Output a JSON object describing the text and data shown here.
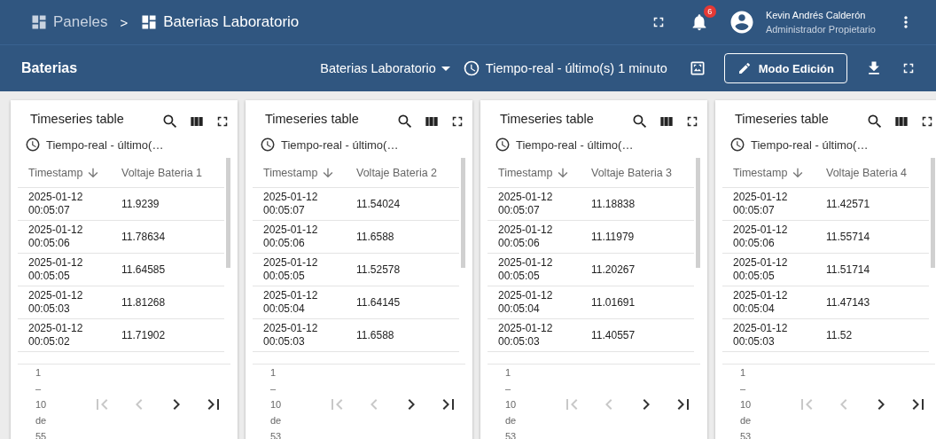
{
  "breadcrumb": [
    {
      "label": "Paneles",
      "current": false
    },
    {
      "label": ">",
      "kind": "separator"
    },
    {
      "label": "Baterias Laboratorio",
      "current": true
    }
  ],
  "notifications": {
    "badge": "6"
  },
  "user": {
    "name": "Kevin Andrés Calderón",
    "role": "Administrador Propietario"
  },
  "toolbar": {
    "title": "Baterias",
    "state_selector": "Baterias Laboratorio",
    "timewindow": "Tiempo-real - último(s) 1 minuto",
    "edit_button": "Modo Edición"
  },
  "panels": [
    {
      "title": "Timeseries table",
      "timewindow": "Tiempo-real - último(…",
      "columns": [
        {
          "label": "Timestamp",
          "sorted": true
        },
        {
          "label": "Voltaje Bateria 1",
          "sorted": false
        }
      ],
      "rows": [
        {
          "timestamp": "2025-01-12\n00:05:07",
          "value": "11.9239"
        },
        {
          "timestamp": "2025-01-12\n00:05:06",
          "value": "11.78634"
        },
        {
          "timestamp": "2025-01-12\n00:05:05",
          "value": "11.64585"
        },
        {
          "timestamp": "2025-01-12\n00:05:03",
          "value": "11.81268"
        },
        {
          "timestamp": "2025-01-12\n00:05:02",
          "value": "11.71902"
        }
      ],
      "pagination": [
        "1",
        "–",
        "10",
        "de",
        "55"
      ],
      "nav": [
        {
          "kind": "first",
          "disabled": true
        },
        {
          "kind": "prev",
          "disabled": true
        },
        {
          "kind": "next",
          "disabled": false
        },
        {
          "kind": "last",
          "disabled": false
        }
      ]
    },
    {
      "title": "Timeseries table",
      "timewindow": "Tiempo-real - último(…",
      "columns": [
        {
          "label": "Timestamp",
          "sorted": true
        },
        {
          "label": "Voltaje Bateria 2",
          "sorted": false
        }
      ],
      "rows": [
        {
          "timestamp": "2025-01-12\n00:05:07",
          "value": "11.54024"
        },
        {
          "timestamp": "2025-01-12\n00:05:06",
          "value": "11.6588"
        },
        {
          "timestamp": "2025-01-12\n00:05:05",
          "value": "11.52578"
        },
        {
          "timestamp": "2025-01-12\n00:05:04",
          "value": "11.64145"
        },
        {
          "timestamp": "2025-01-12\n00:05:03",
          "value": "11.6588"
        }
      ],
      "pagination": [
        "1",
        "–",
        "10",
        "de",
        "53"
      ],
      "nav": [
        {
          "kind": "first",
          "disabled": true
        },
        {
          "kind": "prev",
          "disabled": true
        },
        {
          "kind": "next",
          "disabled": false
        },
        {
          "kind": "last",
          "disabled": false
        }
      ]
    },
    {
      "title": "Timeseries table",
      "timewindow": "Tiempo-real - último(…",
      "columns": [
        {
          "label": "Timestamp",
          "sorted": true
        },
        {
          "label": "Voltaje Bateria 3",
          "sorted": false
        }
      ],
      "rows": [
        {
          "timestamp": "2025-01-12\n00:05:07",
          "value": "11.18838"
        },
        {
          "timestamp": "2025-01-12\n00:05:06",
          "value": "11.11979"
        },
        {
          "timestamp": "2025-01-12\n00:05:05",
          "value": "11.20267"
        },
        {
          "timestamp": "2025-01-12\n00:05:04",
          "value": "11.01691"
        },
        {
          "timestamp": "2025-01-12\n00:05:03",
          "value": "11.40557"
        }
      ],
      "pagination": [
        "1",
        "–",
        "10",
        "de",
        "53"
      ],
      "nav": [
        {
          "kind": "first",
          "disabled": true
        },
        {
          "kind": "prev",
          "disabled": true
        },
        {
          "kind": "next",
          "disabled": false
        },
        {
          "kind": "last",
          "disabled": false
        }
      ]
    },
    {
      "title": "Timeseries table",
      "timewindow": "Tiempo-real - último(…",
      "columns": [
        {
          "label": "Timestamp",
          "sorted": true
        },
        {
          "label": "Voltaje Bateria 4",
          "sorted": false
        }
      ],
      "rows": [
        {
          "timestamp": "2025-01-12\n00:05:07",
          "value": "11.42571"
        },
        {
          "timestamp": "2025-01-12\n00:05:06",
          "value": "11.55714"
        },
        {
          "timestamp": "2025-01-12\n00:05:05",
          "value": "11.51714"
        },
        {
          "timestamp": "2025-01-12\n00:05:04",
          "value": "11.47143"
        },
        {
          "timestamp": "2025-01-12\n00:05:03",
          "value": "11.52"
        }
      ],
      "pagination": [
        "1",
        "–",
        "10",
        "de",
        "53"
      ],
      "nav": [
        {
          "kind": "first",
          "disabled": true
        },
        {
          "kind": "prev",
          "disabled": true
        },
        {
          "kind": "next",
          "disabled": false
        },
        {
          "kind": "last",
          "disabled": false
        }
      ]
    }
  ]
}
